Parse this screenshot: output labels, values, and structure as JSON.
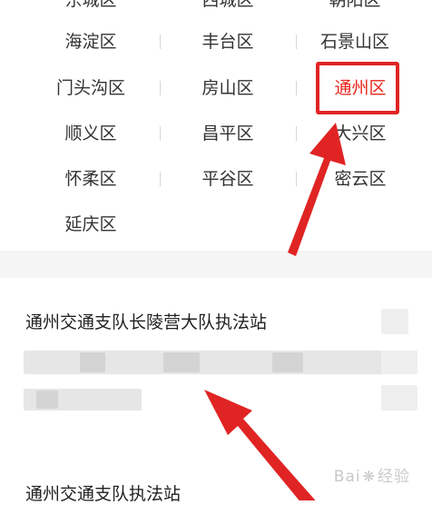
{
  "district_grid": {
    "rows": [
      [
        "东城区",
        "西城区",
        "朝阳区"
      ],
      [
        "海淀区",
        "丰台区",
        "石景山区"
      ],
      [
        "门头沟区",
        "房山区",
        "通州区"
      ],
      [
        "顺义区",
        "昌平区",
        "大兴区"
      ],
      [
        "怀柔区",
        "平谷区",
        "密云区"
      ],
      [
        "延庆区"
      ]
    ],
    "selected": "通州区",
    "selected_color": "#e8251a"
  },
  "results": [
    {
      "title": "通州交通支队长陵营大队执法站"
    },
    {
      "title": "通州交通支队执法站"
    }
  ],
  "annotation": {
    "color": "#e02424"
  },
  "watermark": {
    "text_a": "Bai",
    "text_b": "经验"
  }
}
